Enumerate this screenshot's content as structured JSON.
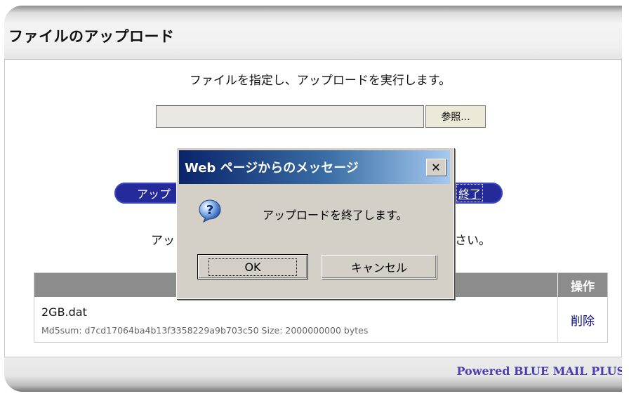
{
  "page": {
    "title": "ファイルのアップロード",
    "instruction": "ファイルを指定し、アップロードを実行します。",
    "file_input_value": "",
    "browse_label": "参照...",
    "upload_button_partial": "アップ",
    "finish_button_partial": "終了",
    "note_left_partial": "アッ",
    "note_right_partial": "さい。"
  },
  "file_table": {
    "header_action": "操作",
    "rows": [
      {
        "name": "2GB.dat",
        "meta": "Md5sum: d7cd17064ba4b13f3358229a9b703c50   Size: 2000000000 bytes",
        "action": "削除"
      }
    ]
  },
  "footer": {
    "text": "Powered BLUE MAIL PLUS"
  },
  "dialog": {
    "title": "Web ページからのメッセージ",
    "close_label": "✕",
    "message": "アップロードを終了します。",
    "ok_label": "OK",
    "cancel_label": "キャンセル",
    "icon": "question-icon"
  },
  "colors": {
    "pill_button": "#242a9a",
    "dialog_title_start": "#0a246a",
    "dialog_title_end": "#a6caf0",
    "footer_text": "#4a3fb0",
    "table_header": "#8c8c8c"
  }
}
